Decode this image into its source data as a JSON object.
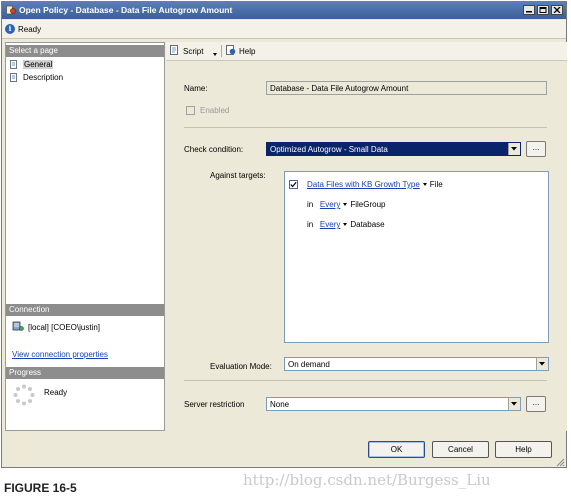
{
  "window": {
    "title": "Open Policy - Database - Data File Autogrow Amount",
    "controls": [
      "minimize",
      "maximize",
      "close"
    ]
  },
  "status": {
    "icon": "info-icon",
    "text": "Ready"
  },
  "left_pane": {
    "pages_header": "Select a page",
    "pages": [
      {
        "label": "General",
        "icon": "page-icon",
        "selected": true
      },
      {
        "label": "Description",
        "icon": "page-icon",
        "selected": false
      }
    ],
    "connection_header": "Connection",
    "connection_text": "[local] [COEO\\justin]",
    "connection_link": "View connection properties",
    "progress_header": "Progress",
    "progress_text": "Ready"
  },
  "toolbar": {
    "script_label": "Script",
    "help_label": "Help"
  },
  "form": {
    "name_label": "Name:",
    "name_value": "Database - Data File Autogrow Amount",
    "enabled_label": "Enabled",
    "check_condition_label": "Check condition:",
    "check_condition_value": "Optimized Autogrow - Small Data",
    "ellipsis": "...",
    "against_targets_label": "Against targets:",
    "targets": {
      "row1_link": "Data Files with KB Growth Type",
      "row1_suffix": "File",
      "row2_prefix": "in",
      "row2_link": "Every",
      "row2_suffix": "FileGroup",
      "row3_prefix": "in",
      "row3_link": "Every",
      "row3_suffix": "Database"
    },
    "evaluation_mode_label": "Evaluation Mode:",
    "evaluation_mode_value": "On demand",
    "server_restriction_label": "Server restriction",
    "server_restriction_value": "None"
  },
  "buttons": {
    "ok": "OK",
    "cancel": "Cancel",
    "help": "Help"
  },
  "caption": "FIGURE 16-5",
  "watermark": "http://blog.csdn.net/Burgess_Liu"
}
